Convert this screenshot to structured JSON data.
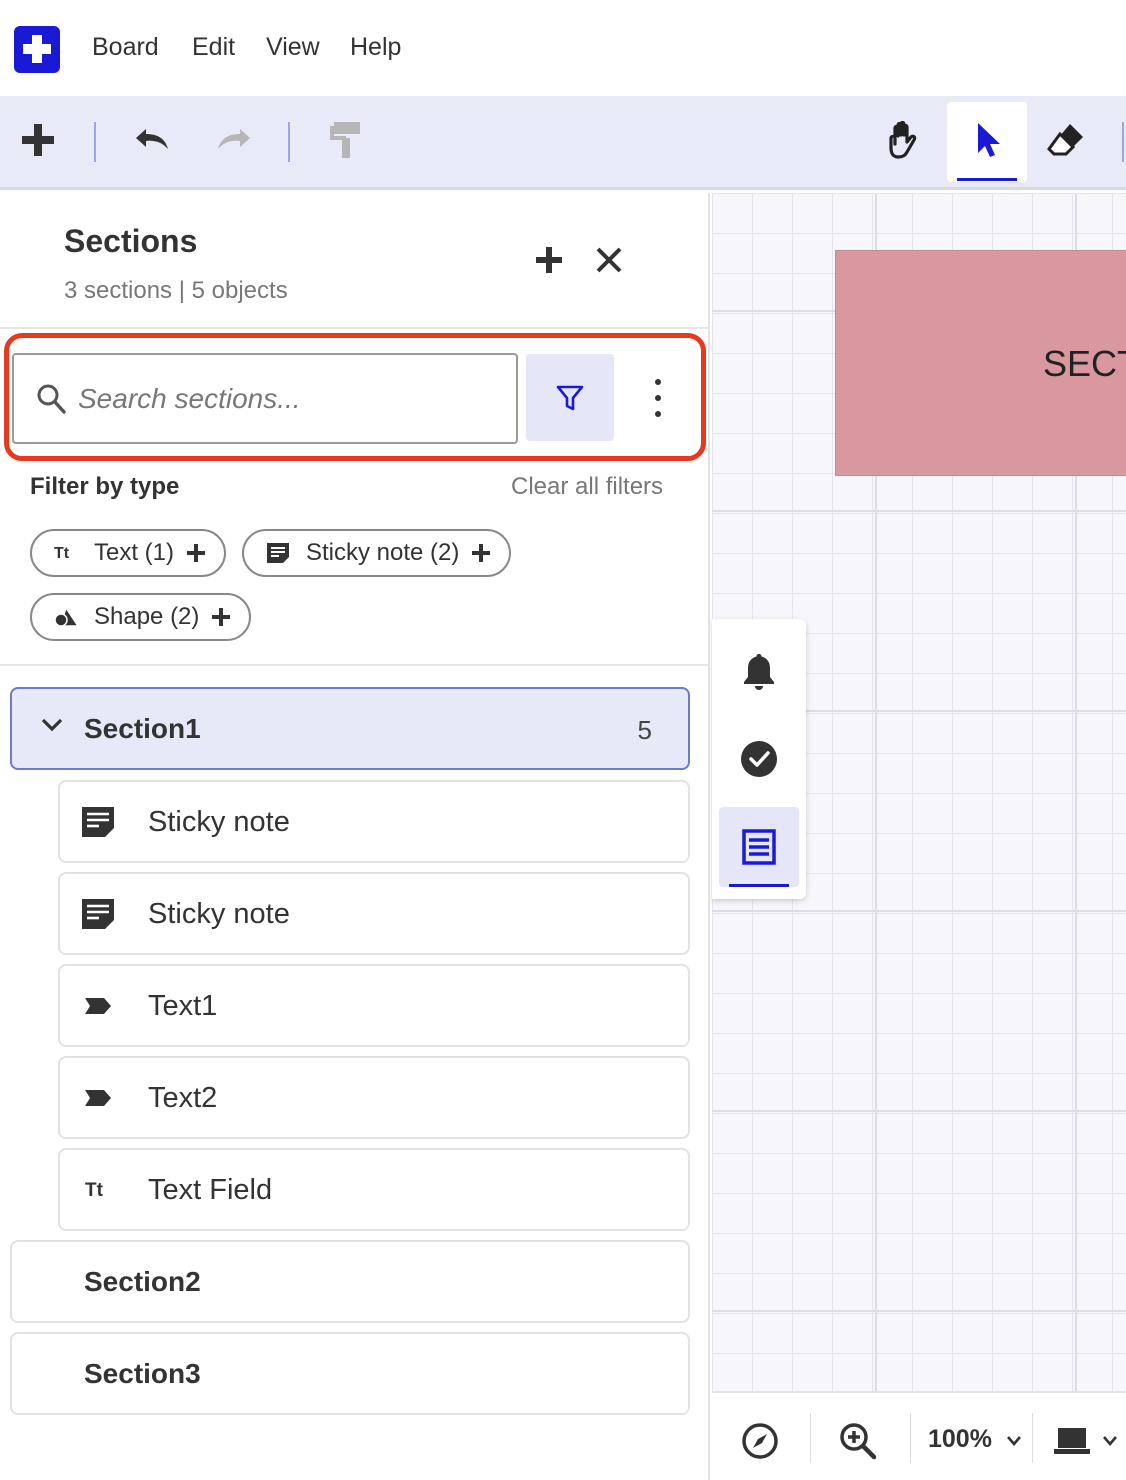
{
  "menubar": {
    "items": [
      "Board",
      "Edit",
      "View",
      "Help"
    ]
  },
  "toolbar": {
    "left_icons": [
      "plus-icon",
      "undo-icon",
      "redo-icon",
      "format-painter-icon"
    ],
    "right_icons": [
      "hand-icon",
      "pointer-icon",
      "eraser-icon"
    ],
    "active_tool": "pointer",
    "accent_color": "#1a1ad6"
  },
  "panel": {
    "title": "Sections",
    "subtitle": "3 sections | 5 objects",
    "search": {
      "placeholder": "Search sections...",
      "value": ""
    },
    "filter_label": "Filter by type",
    "clear_filters": "Clear all filters",
    "chips": [
      {
        "label": "Text (1)",
        "icon": "text-type-icon"
      },
      {
        "label": "Sticky note (2)",
        "icon": "sticky-note-icon"
      },
      {
        "label": "Shape (2)",
        "icon": "shape-icon"
      }
    ],
    "sections": [
      {
        "name": "Section1",
        "count": "5",
        "expanded": true,
        "children": [
          {
            "label": "Sticky note",
            "icon": "sticky-note-icon"
          },
          {
            "label": "Sticky note",
            "icon": "sticky-note-icon"
          },
          {
            "label": "Text1",
            "icon": "label-tag-icon"
          },
          {
            "label": "Text2",
            "icon": "label-tag-icon"
          },
          {
            "label": "Text Field",
            "icon": "text-type-icon"
          }
        ]
      },
      {
        "name": "Section2",
        "count": "",
        "expanded": false,
        "children": []
      },
      {
        "name": "Section3",
        "count": "",
        "expanded": false,
        "children": []
      }
    ],
    "highlight_color": "#e8381f"
  },
  "canvas": {
    "section_block_label": "SECT",
    "section_block_color": "#d8989e",
    "side_tools": [
      "bell-icon",
      "check-circle-icon",
      "list-icon"
    ],
    "zoom": "100%"
  }
}
